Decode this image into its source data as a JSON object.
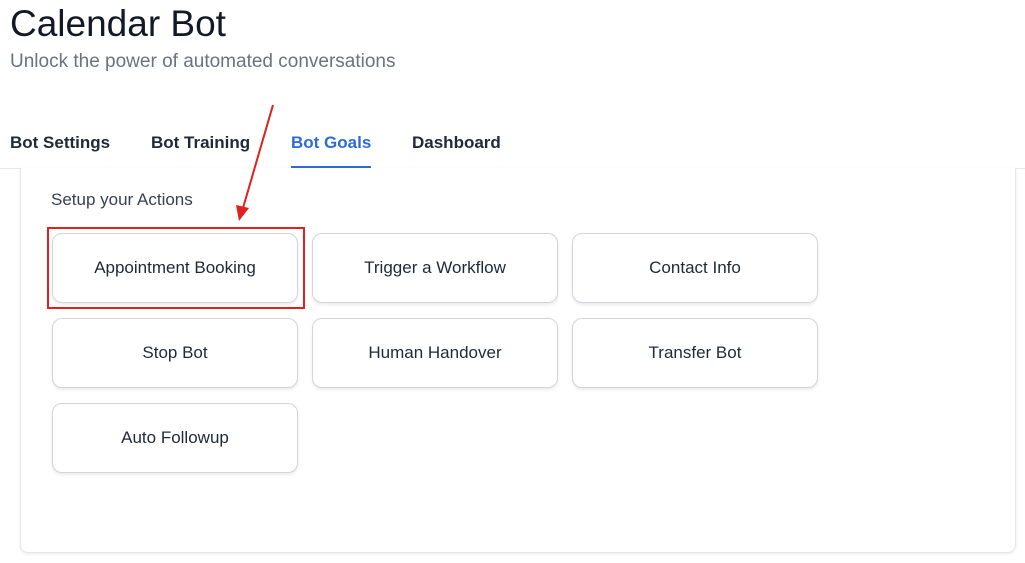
{
  "header": {
    "title": "Calendar Bot",
    "subtitle": "Unlock the power of automated conversations"
  },
  "tabs": [
    {
      "label": "Bot Settings",
      "active": false
    },
    {
      "label": "Bot Training",
      "active": false
    },
    {
      "label": "Bot Goals",
      "active": true
    },
    {
      "label": "Dashboard",
      "active": false
    }
  ],
  "actions_section": {
    "label": "Setup your Actions",
    "actions": [
      {
        "label": "Appointment Booking",
        "highlighted": true
      },
      {
        "label": "Trigger a Workflow"
      },
      {
        "label": "Contact Info"
      },
      {
        "label": "Stop Bot"
      },
      {
        "label": "Human Handover"
      },
      {
        "label": "Transfer Bot"
      },
      {
        "label": "Auto Followup"
      }
    ]
  },
  "colors": {
    "accent": "#2f6bd8",
    "annotation": "#e0201b",
    "title_text": "#111827",
    "subtitle_text": "#6b7280"
  }
}
